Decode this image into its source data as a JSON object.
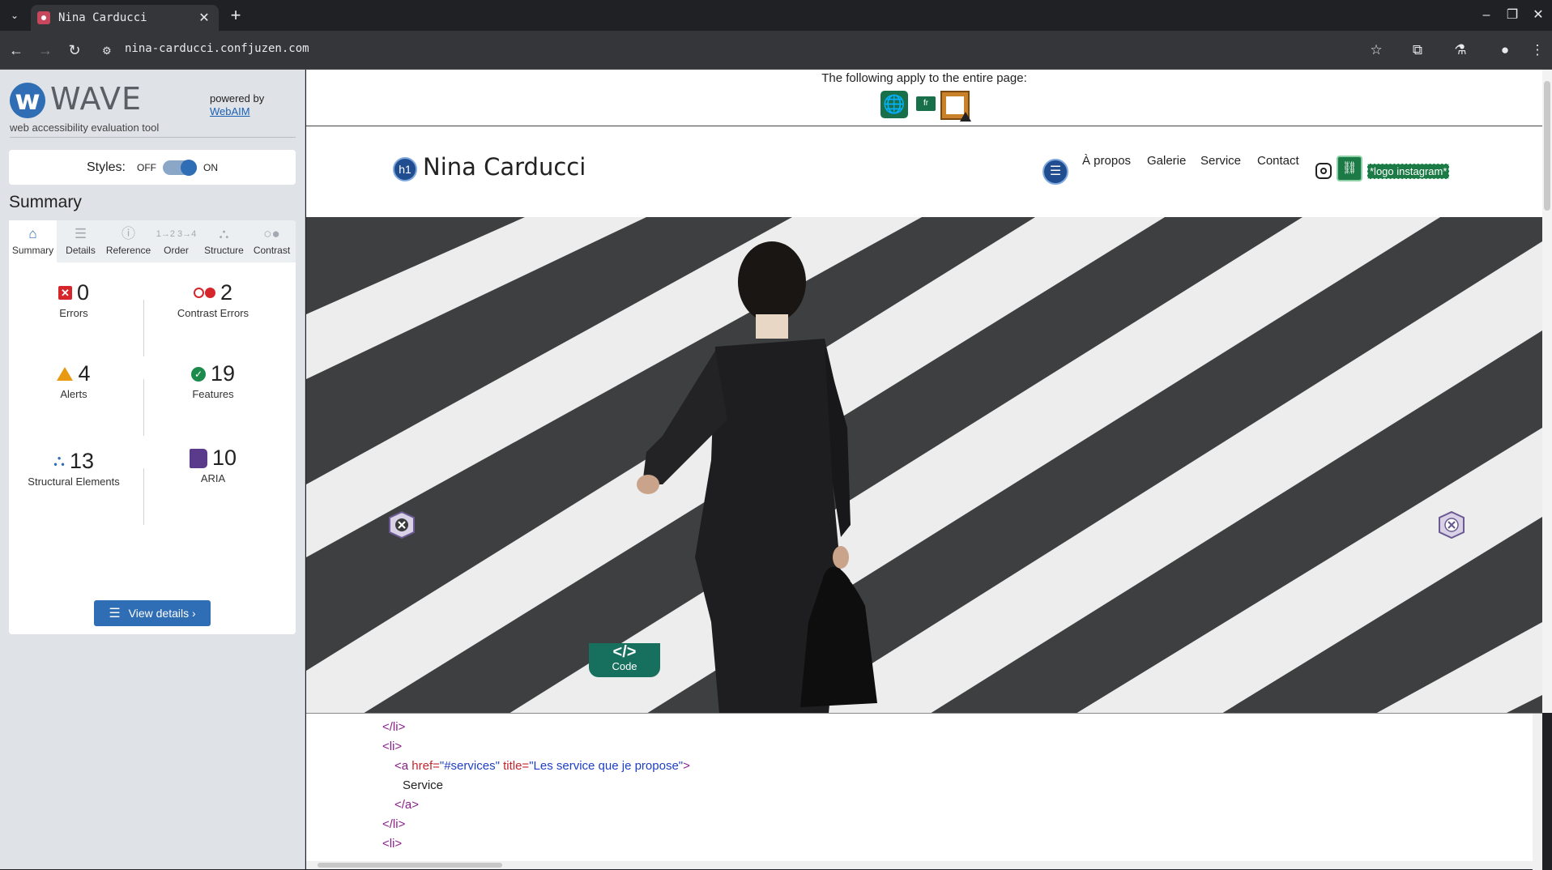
{
  "browser": {
    "tab_title": "Nina Carducci",
    "url": "nina-carducci.confjuzen.com"
  },
  "wave": {
    "brand": "WAVE",
    "tagline": "web accessibility evaluation tool",
    "powered_by": "powered by",
    "webaim": "WebAIM",
    "styles_label": "Styles:",
    "styles_off": "OFF",
    "styles_on": "ON",
    "summary_title": "Summary",
    "tabs": [
      "Summary",
      "Details",
      "Reference",
      "Order",
      "Structure",
      "Contrast"
    ],
    "active_tab": "Summary",
    "stats": {
      "errors": {
        "value": "0",
        "label": "Errors"
      },
      "contrast_errors": {
        "value": "2",
        "label": "Contrast Errors"
      },
      "alerts": {
        "value": "4",
        "label": "Alerts"
      },
      "features": {
        "value": "19",
        "label": "Features"
      },
      "structural": {
        "value": "13",
        "label": "Structural Elements"
      },
      "aria": {
        "value": "10",
        "label": "ARIA"
      }
    },
    "view_details": "View details ›"
  },
  "page": {
    "wave_notice": "The following apply to the entire page:",
    "lang_badge": "fr",
    "h1_badge": "h1",
    "site_title": "Nina Carducci",
    "nav": [
      "À propos",
      "Galerie",
      "Service",
      "Contact"
    ],
    "alt_text": "*logo instagram*"
  },
  "code_panel": {
    "tab_label": "Code",
    "tab_symbol": "</>",
    "line1": "</li>",
    "line2": "<li>",
    "line3_open": "<a ",
    "line3_attr1": "href=",
    "line3_val1": "\"#services\"",
    "line3_attr2": " title=",
    "line3_val2": "\"Les service que je propose\"",
    "line3_close": ">",
    "line4": "Service",
    "line5": "</a>",
    "line6": "</li>",
    "line7": "<li>"
  },
  "colors": {
    "wave_blue": "#2f6db5",
    "error_red": "#d6262c",
    "alert_orange": "#e89a12",
    "feature_green": "#1c8a4b",
    "aria_purple": "#5a3a8a",
    "code_tab_teal": "#17705e"
  }
}
